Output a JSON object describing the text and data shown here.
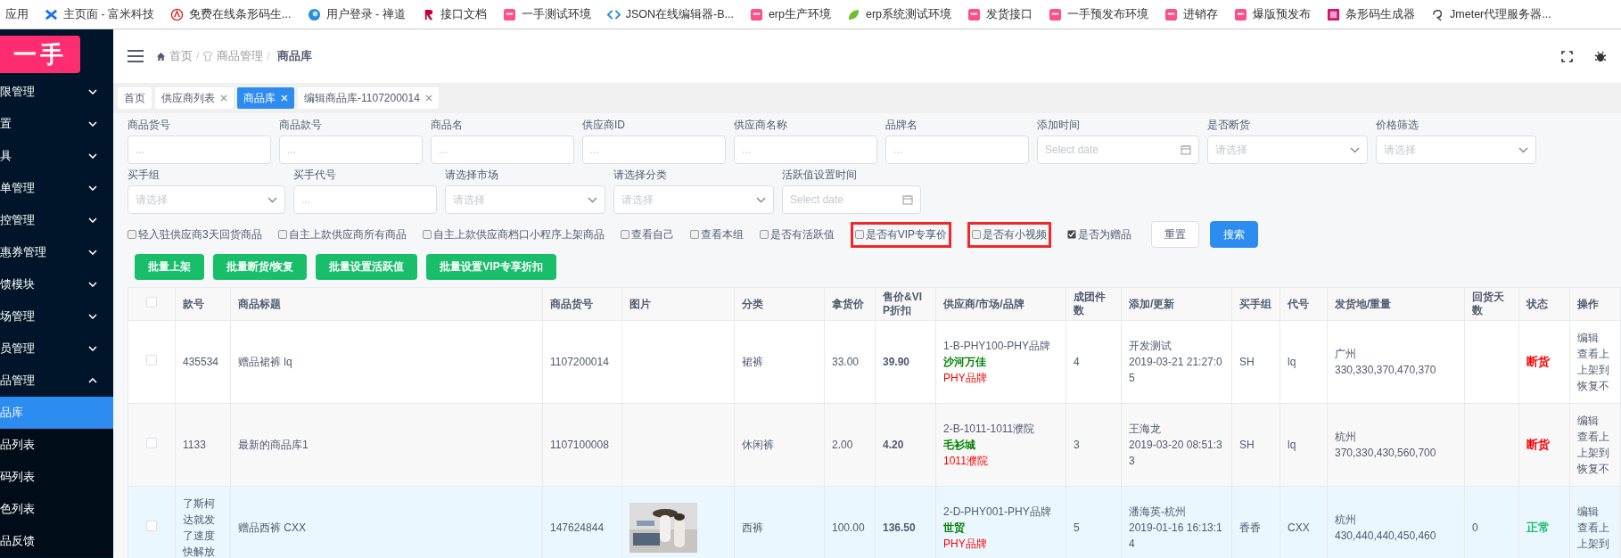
{
  "bookmarks": [
    {
      "label": "应用",
      "kind": "plain"
    },
    {
      "label": "主页面 - 富米科技",
      "kind": "cross"
    },
    {
      "label": "免费在线条形码生...",
      "kind": "stamp"
    },
    {
      "label": "用户登录 - 禅道",
      "kind": "globe"
    },
    {
      "label": "接口文档",
      "kind": "ribbon"
    },
    {
      "label": "一手测试环境",
      "kind": "tile"
    },
    {
      "label": "JSON在线编辑器-B...",
      "kind": "code"
    },
    {
      "label": "erp生产环境",
      "kind": "tile"
    },
    {
      "label": "erp系统测试环境",
      "kind": "leaf"
    },
    {
      "label": "发货接口",
      "kind": "tile"
    },
    {
      "label": "一手预发布环境",
      "kind": "tile"
    },
    {
      "label": "进销存",
      "kind": "tile"
    },
    {
      "label": "爆版预发布",
      "kind": "tile"
    },
    {
      "label": "条形码生成器",
      "kind": "square"
    },
    {
      "label": "Jmeter代理服务器...",
      "kind": "swirl"
    }
  ],
  "logo": "一手",
  "sidebar": {
    "items": [
      {
        "label": "限管理",
        "expanded": false
      },
      {
        "label": "置",
        "expanded": false
      },
      {
        "label": "具",
        "expanded": false
      },
      {
        "label": "单管理",
        "expanded": false
      },
      {
        "label": "控管理",
        "expanded": false
      },
      {
        "label": "惠券管理",
        "expanded": false
      },
      {
        "label": "馈模块",
        "expanded": false
      },
      {
        "label": "场管理",
        "expanded": false
      },
      {
        "label": "员管理",
        "expanded": false
      },
      {
        "label": "品管理",
        "expanded": true,
        "children": [
          {
            "label": "品库",
            "selected": true
          },
          {
            "label": "品列表",
            "selected": false
          },
          {
            "label": "码列表",
            "selected": false
          },
          {
            "label": "色列表",
            "selected": false
          },
          {
            "label": "品反馈",
            "selected": false
          }
        ]
      }
    ]
  },
  "breadcrumb": [
    {
      "label": "首页",
      "kind": "home"
    },
    {
      "separator": "/",
      "label": "商品管理",
      "kind": "shirt"
    },
    {
      "separator": "/",
      "label": "商品库",
      "kind": "plain"
    }
  ],
  "tabs": [
    {
      "label": "首页",
      "selected": false,
      "closable": false
    },
    {
      "label": "供应商列表",
      "selected": false,
      "closable": true
    },
    {
      "label": "商品库",
      "selected": true,
      "closable": true
    },
    {
      "label": "编辑商品库-1107200014",
      "selected": false,
      "closable": true
    }
  ],
  "filters": {
    "rows": [
      [
        {
          "label": "商品货号",
          "kind": "text",
          "placeholder": "..."
        },
        {
          "label": "商品款号",
          "kind": "text",
          "placeholder": "..."
        },
        {
          "label": "商品名",
          "kind": "text",
          "placeholder": "..."
        },
        {
          "label": "供应商ID",
          "kind": "text",
          "placeholder": "..."
        },
        {
          "label": "供应商名称",
          "kind": "text",
          "placeholder": "..."
        },
        {
          "label": "品牌名",
          "kind": "text",
          "placeholder": "..."
        },
        {
          "label": "添加时间",
          "kind": "date",
          "placeholder": "Select date"
        },
        {
          "label": "是否断货",
          "kind": "select",
          "placeholder": "请选择"
        },
        {
          "label": "价格筛选",
          "kind": "select",
          "placeholder": "请选择"
        }
      ],
      [
        {
          "label": "买手组",
          "kind": "select",
          "placeholder": "请选择"
        },
        {
          "label": "买手代号",
          "kind": "text",
          "placeholder": "..."
        },
        {
          "label": "请选择市场",
          "kind": "select",
          "placeholder": "请选择"
        },
        {
          "label": "请选择分类",
          "kind": "select",
          "placeholder": "请选择"
        },
        {
          "label": "活跃值设置时间",
          "kind": "date",
          "placeholder": "Select date"
        }
      ]
    ],
    "checkboxes": [
      {
        "label": "轻入驻供应商3天回货商品",
        "checked": false,
        "highlighted": false
      },
      {
        "label": "自主上款供应商所有商品",
        "checked": false,
        "highlighted": false
      },
      {
        "label": "自主上款供应商档口小程序上架商品",
        "checked": false,
        "highlighted": false
      },
      {
        "label": "查看自己",
        "checked": false,
        "highlighted": false
      },
      {
        "label": "查看本组",
        "checked": false,
        "highlighted": false
      },
      {
        "label": "是否有活跃值",
        "checked": false,
        "highlighted": false
      },
      {
        "label": "是否有VIP专享价",
        "checked": false,
        "highlighted": true
      },
      {
        "label": "是否有小视频",
        "checked": false,
        "highlighted": true
      },
      {
        "label": "是否为赠品",
        "checked": true,
        "highlighted": false
      }
    ],
    "actions": [
      {
        "label": "重置",
        "kind": "default"
      },
      {
        "label": "搜索",
        "kind": "primary"
      }
    ]
  },
  "batch_buttons": [
    "批量上架",
    "批量断货/恢复",
    "批量设置活跃值",
    "批量设置VIP专享折扣"
  ],
  "table": {
    "select_all": {
      "checked": false
    },
    "columns": [
      "款号",
      "商品标题",
      "商品货号",
      "图片",
      "分类",
      "拿货价",
      "售价&VIP折扣",
      "供应商/市场/品牌",
      "成团件数",
      "添加/更新",
      "买手组",
      "代号",
      "发货地/重量",
      "回货天数",
      "状态",
      "操作"
    ],
    "rows": [
      {
        "checked": false,
        "highlighted": false,
        "style_no": "435534",
        "title": "赠品裙裤 lq",
        "sku": "1107200014",
        "category": "裙裤",
        "cost": "33.00",
        "price": "39.90",
        "supplier": {
          "code": "1-B-PHY100-PHY品牌",
          "market": "沙河万佳",
          "brand": "PHY品牌"
        },
        "group_count": "4",
        "added": {
          "by": "开发测试",
          "time": "2019-03-21 21:27:05"
        },
        "buyer_group": "SH",
        "buyer_code": "lq",
        "shipping": {
          "city": "广州",
          "weights": "330,330,370,470,370"
        },
        "status": {
          "text": "断货",
          "color": "#ff0000"
        },
        "actions": [
          "编辑",
          "查看上",
          "上架到",
          "恢复不"
        ]
      },
      {
        "checked": false,
        "highlighted": false,
        "style_no": "1133",
        "title": "最新的商品库1",
        "sku": "1107100008",
        "category": "休闲裤",
        "cost": "2.00",
        "price": "4.20",
        "supplier": {
          "code": "2-B-1011-1011濮院",
          "market": "毛衫城",
          "brand": "1011濮院"
        },
        "group_count": "3",
        "added": {
          "by": "王海龙",
          "time": "2019-03-20 08:51:33"
        },
        "buyer_group": "SH",
        "buyer_code": "lq",
        "shipping": {
          "city": "杭州",
          "weights": "370,330,430,560,700"
        },
        "status": {
          "text": "断货",
          "color": "#ff0000"
        },
        "actions": [
          "编辑",
          "查看上",
          "上架到",
          "恢复不"
        ]
      },
      {
        "checked": false,
        "highlighted": true,
        "style_no": "了斯柯达就发了速度快解放",
        "title": "赠品西裤 CXX",
        "sku": "147624844",
        "image": {
          "kind": "picture"
        },
        "category": "西裤",
        "cost": "100.00",
        "price": "136.50",
        "supplier": {
          "code": "2-D-PHY001-PHY品牌",
          "market": "世贸",
          "brand": "PHY品牌"
        },
        "group_count": "5",
        "added": {
          "by": "潘海英-杭州",
          "time": "2019-01-16 16:13:14"
        },
        "buyer_group": "香香",
        "buyer_code": "CXX",
        "shipping": {
          "city": "杭州",
          "weights": "430,440,440,450,460"
        },
        "return_days": "0",
        "status": {
          "text": "正常",
          "color": "#19be6b"
        },
        "actions": [
          "编辑",
          "查看上",
          "上架到"
        ]
      }
    ]
  }
}
